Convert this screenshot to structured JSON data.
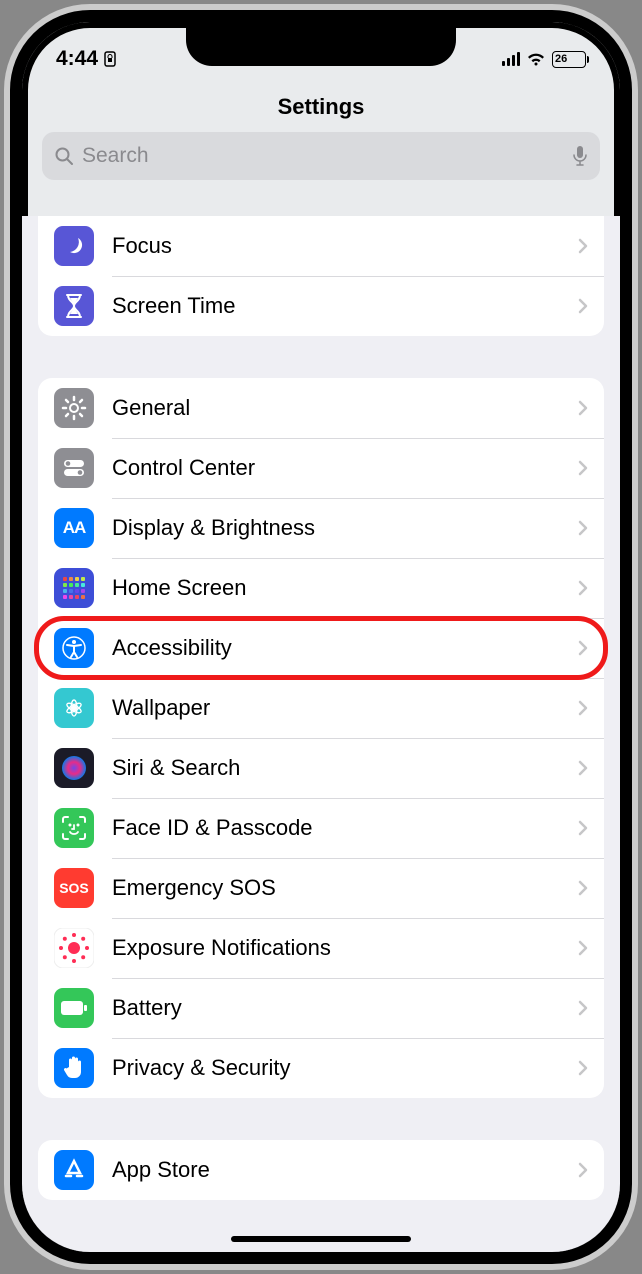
{
  "status": {
    "time": "4:44",
    "battery_pct": "26"
  },
  "header": {
    "title": "Settings"
  },
  "search": {
    "placeholder": "Search"
  },
  "groups": [
    {
      "items": [
        {
          "id": "focus",
          "label": "Focus",
          "icon": "moon",
          "color": "#5856d6"
        },
        {
          "id": "screen-time",
          "label": "Screen Time",
          "icon": "hourglass",
          "color": "#5856d6"
        }
      ]
    },
    {
      "items": [
        {
          "id": "general",
          "label": "General",
          "icon": "gear",
          "color": "#8e8e93"
        },
        {
          "id": "control-center",
          "label": "Control Center",
          "icon": "switches",
          "color": "#8e8e93"
        },
        {
          "id": "display",
          "label": "Display & Brightness",
          "icon": "aa",
          "color": "#007aff"
        },
        {
          "id": "home-screen",
          "label": "Home Screen",
          "icon": "grid",
          "color": "#3d4ed7"
        },
        {
          "id": "accessibility",
          "label": "Accessibility",
          "icon": "accessibility",
          "color": "#007aff",
          "highlighted": true
        },
        {
          "id": "wallpaper",
          "label": "Wallpaper",
          "icon": "flower",
          "color": "#34c8d1"
        },
        {
          "id": "siri",
          "label": "Siri & Search",
          "icon": "siri",
          "color": "#1b1b28"
        },
        {
          "id": "faceid",
          "label": "Face ID & Passcode",
          "icon": "faceid",
          "color": "#34c759"
        },
        {
          "id": "sos",
          "label": "Emergency SOS",
          "icon": "sos",
          "color": "#ff3b30"
        },
        {
          "id": "exposure",
          "label": "Exposure Notifications",
          "icon": "exposure",
          "color": "#ffffff"
        },
        {
          "id": "battery",
          "label": "Battery",
          "icon": "battery",
          "color": "#34c759"
        },
        {
          "id": "privacy",
          "label": "Privacy & Security",
          "icon": "hand",
          "color": "#007aff"
        }
      ]
    },
    {
      "items": [
        {
          "id": "app-store",
          "label": "App Store",
          "icon": "appstore",
          "color": "#007aff"
        }
      ]
    }
  ]
}
